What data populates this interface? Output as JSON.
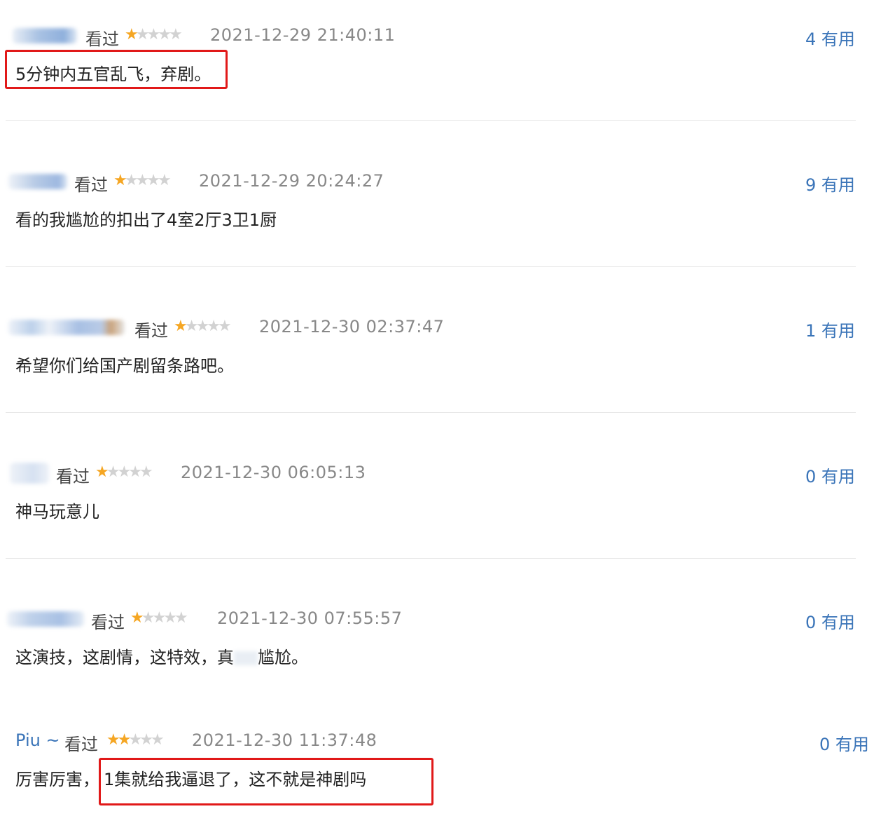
{
  "comments": [
    {
      "user": "",
      "watched": "看过",
      "stars": [
        true,
        false,
        false,
        false,
        false
      ],
      "date": "2021-12-29 21:40:11",
      "useful": "4 有用",
      "text": "5分钟内五官乱飞，弃剧。"
    },
    {
      "user": "",
      "watched": "看过",
      "stars": [
        true,
        false,
        false,
        false,
        false
      ],
      "date": "2021-12-29 20:24:27",
      "useful": "9 有用",
      "text": "看的我尴尬的扣出了4室2厅3卫1厨"
    },
    {
      "user": "",
      "watched": "看过",
      "stars": [
        true,
        false,
        false,
        false,
        false
      ],
      "date": "2021-12-30 02:37:47",
      "useful": "1 有用",
      "text": "希望你们给国产剧留条路吧。"
    },
    {
      "user": "",
      "watched": "看过",
      "stars": [
        true,
        false,
        false,
        false,
        false
      ],
      "date": "2021-12-30 06:05:13",
      "useful": "0 有用",
      "text": "神马玩意儿"
    },
    {
      "user": "",
      "watched": "看过",
      "stars": [
        true,
        false,
        false,
        false,
        false
      ],
      "date": "2021-12-30 07:55:57",
      "useful": "0 有用",
      "text_a": "这演技，这剧情，这特效，真",
      "text_b": "尴尬。"
    },
    {
      "user": "Piu ~",
      "watched": "看过",
      "stars": [
        true,
        true,
        false,
        false,
        false
      ],
      "date": "2021-12-30 11:37:48",
      "useful": "0 有用",
      "text_a": "厉害厉害，",
      "text_b": "1集就给我逼退了，这不就是神剧吗"
    }
  ],
  "colors": {
    "link": "#3a74b8",
    "star_on": "#f5a623",
    "star_off": "#d2d2d2",
    "highlight": "#e11919"
  }
}
